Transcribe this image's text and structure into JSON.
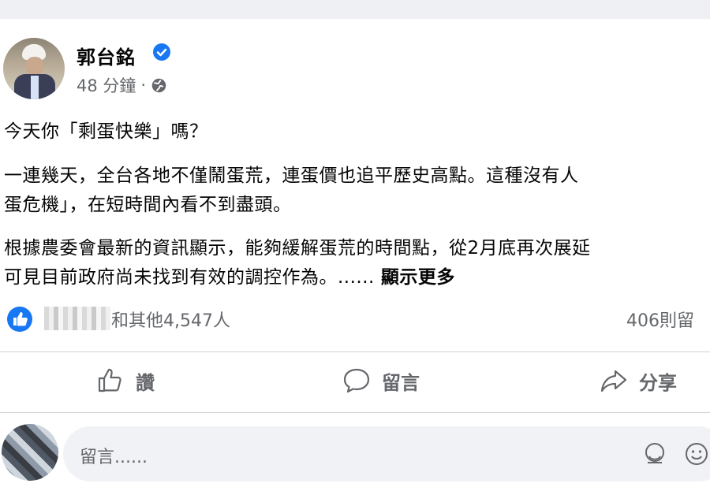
{
  "post": {
    "author": "郭台銘",
    "time": "48 分鐘",
    "dot": "·",
    "lines": {
      "p1": "今天你「剩蛋快樂」嗎？",
      "p2a": "一連幾天，全台各地不僅鬧蛋荒，連蛋價也追平歷史高點。這種沒有人",
      "p2b": "蛋危機」，在短時間內看不到盡頭。",
      "p3a": "根據農委會最新的資訊顯示，能夠緩解蛋荒的時間點，從2月底再次展延",
      "p3b": "可見目前政府尚未找到有效的調控作為。......"
    },
    "see_more": "顯示更多"
  },
  "reactions": {
    "others_text": "和其他4,547人",
    "comments_text": "406則留"
  },
  "actions": {
    "like": "讚",
    "comment": "留言",
    "share": "分享"
  },
  "comment_box": {
    "placeholder": "留言......"
  },
  "colors": {
    "verified": "#1877f2",
    "secondary_text": "#65676b",
    "input_bg": "#f0f2f5"
  }
}
